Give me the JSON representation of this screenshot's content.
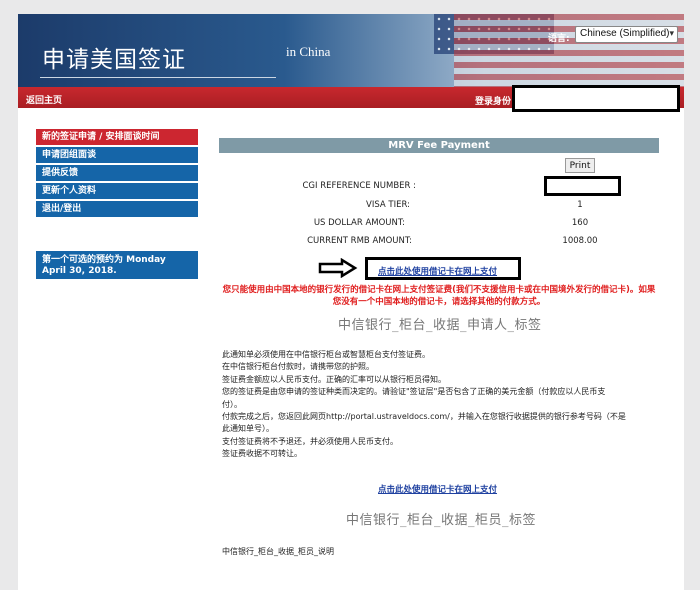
{
  "header": {
    "title": "申请美国签证",
    "subtitle": "in China",
    "language_label": "语言:",
    "language_value": "Chinese (Simplified)"
  },
  "topbar": {
    "home": "返回主页",
    "login": "登录身份"
  },
  "sidebar": {
    "items": [
      {
        "label": "新的签证申请 / 安排面谈时间",
        "active": true
      },
      {
        "label": "申请团组面谈"
      },
      {
        "label": "提供反馈"
      },
      {
        "label": "更新个人资料"
      },
      {
        "label": "退出/登出"
      }
    ],
    "notice": "第一个可选的预约为 Monday April 30, 2018."
  },
  "main": {
    "panel_title": "MRV Fee Payment",
    "print_label": "Print",
    "rows": [
      {
        "label": "CGI REFERENCE NUMBER :",
        "value": ""
      },
      {
        "label": "VISA TIER:",
        "value": "1"
      },
      {
        "label": "US DOLLAR AMOUNT:",
        "value": "160"
      },
      {
        "label": "CURRENT RMB AMOUNT:",
        "value": "1008.00"
      }
    ],
    "pay_link": "点击此处使用借记卡在网上支付",
    "warning": "您只能使用由中国本地的银行发行的借记卡在网上支付签证费(我们不支援信用卡或在中国境外发行的借记卡)。如果您没有一个中国本地的借记卡，请选择其他的付款方式。",
    "title1": "中信银行_柜台_收据_申请人_标签",
    "body_lines": [
      "此通知单必须使用在中信银行柜台或智慧柜台支付签证费。",
      "在中信银行柜台付款时，请携带您的护照。",
      "签证费金额应以人民币支付。正确的汇率可以从银行柜员得知。",
      "您的签证费是由您申请的签证种类而决定的。请验证\"签证层\"是否包含了正确的美元金额（付款应以人民币支",
      "付）。",
      "付款完成之后，您返回此网页http://portal.ustraveldocs.com/，并输入在您银行收据提供的银行参考号码（不是",
      "此通知单号）。",
      "支付签证费将不予退还，并必须使用人民币支付。",
      "签证费收据不可转让。"
    ],
    "pay_link2": "点击此处使用借记卡在网上支付",
    "title2": "中信银行_柜台_收据_柜员_标签",
    "footer_note": "中信银行_柜台_收据_柜员_说明"
  }
}
